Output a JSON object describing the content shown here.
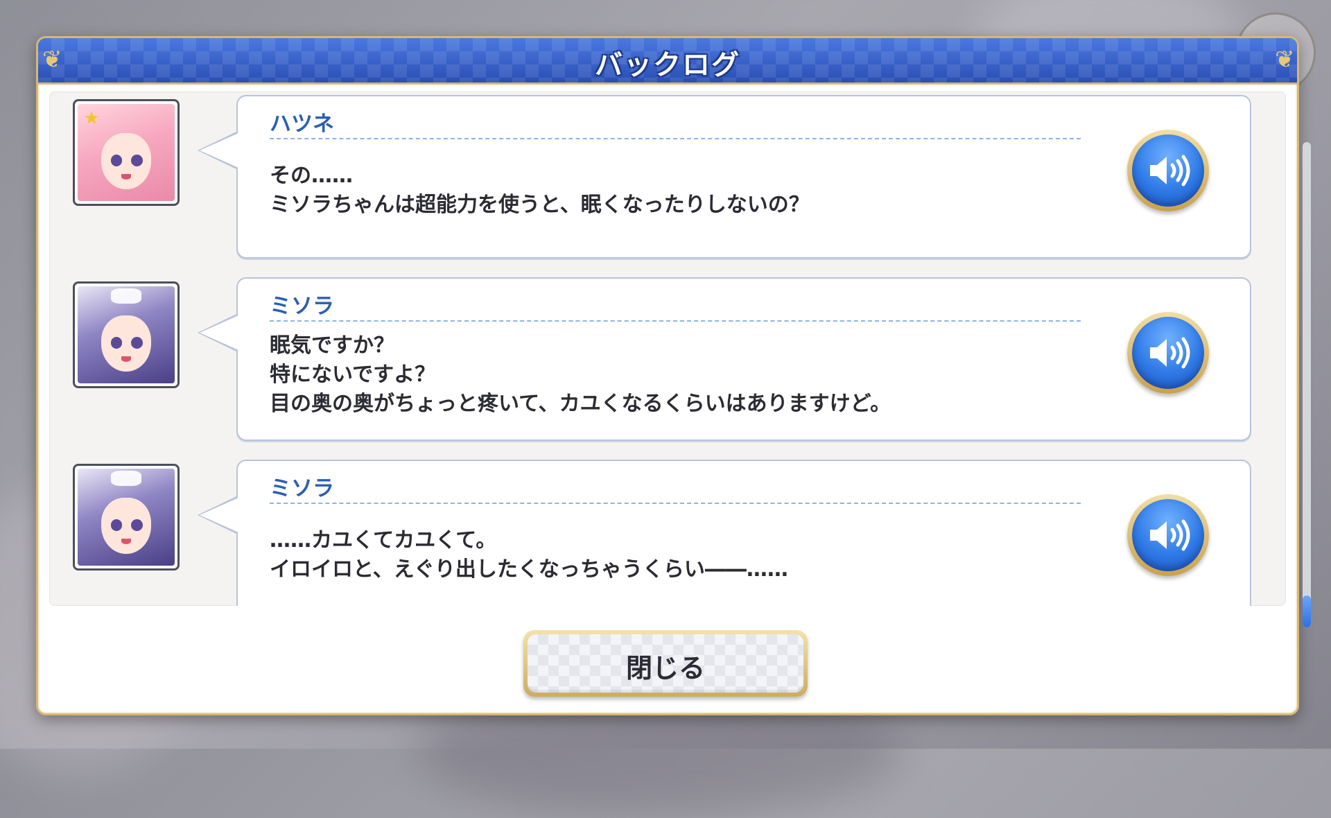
{
  "window": {
    "title": "バックログ"
  },
  "entries": [
    {
      "speaker": "ハツネ",
      "avatar_icon": "hatsune-portrait",
      "lines": [
        "その……",
        "ミソラちゃんは超能力を使うと、眠くなったりしないの？"
      ],
      "voice_icon": "speaker-icon"
    },
    {
      "speaker": "ミソラ",
      "avatar_icon": "misora-portrait",
      "lines": [
        "眠気ですか？",
        "特にないですよ？",
        "目の奥の奥がちょっと疼いて、カユくなるくらいはありますけど。"
      ],
      "voice_icon": "speaker-icon"
    },
    {
      "speaker": "ミソラ",
      "avatar_icon": "misora-portrait",
      "lines": [
        "……カユくてカユくて。",
        "イロイロと、えぐり出したくなっちゃうくらい――……"
      ],
      "voice_icon": "speaker-icon"
    }
  ],
  "close_button": {
    "label": "閉じる"
  },
  "scroll": {
    "position_fraction": 1.0
  },
  "colors": {
    "header_blue": "#2f59c2",
    "gold_border": "#d8b775",
    "speaker_name": "#2c5fb0",
    "voice_button": "#2f7ae6"
  }
}
